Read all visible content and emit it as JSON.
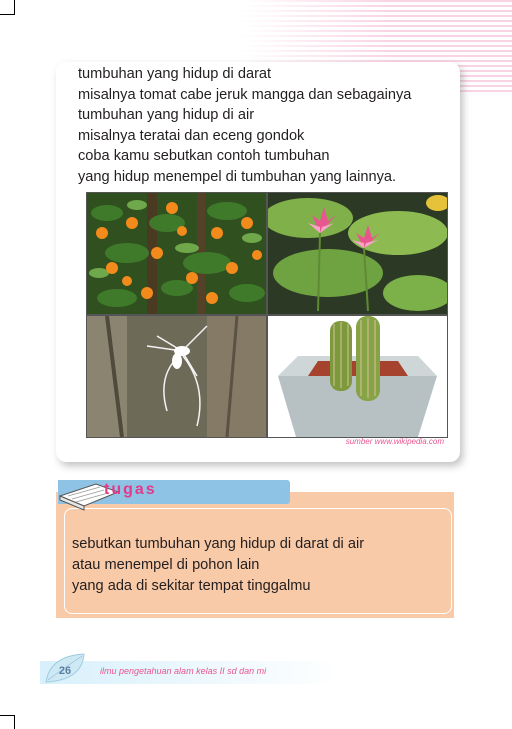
{
  "body_lines": [
    "tumbuhan yang hidup di darat",
    "misalnya tomat cabe jeruk mangga dan sebagainya",
    "tumbuhan yang hidup di air",
    "misalnya teratai dan eceng gondok",
    "coba kamu sebutkan contoh tumbuhan",
    "yang hidup menempel di tumbuhan yang lainnya."
  ],
  "photos": [
    {
      "icon": "orange-tree-photo"
    },
    {
      "icon": "lotus-photo"
    },
    {
      "icon": "orchid-photo"
    },
    {
      "icon": "cactus-pot-photo"
    }
  ],
  "source_caption": "sumber www.wikipedia.com",
  "task": {
    "title": "tugas",
    "lines": [
      "sebutkan tumbuhan yang hidup di darat di air",
      "atau menempel di pohon lain",
      "yang ada di sekitar tempat tinggalmu"
    ]
  },
  "footer": {
    "page_number": "26",
    "book_title": "ilmu pengetahuan alam kelas II sd dan mi"
  },
  "colors": {
    "accent_pink": "#e9558f",
    "task_background": "#f9caa7",
    "tag_blue": "#8fc3e6"
  }
}
